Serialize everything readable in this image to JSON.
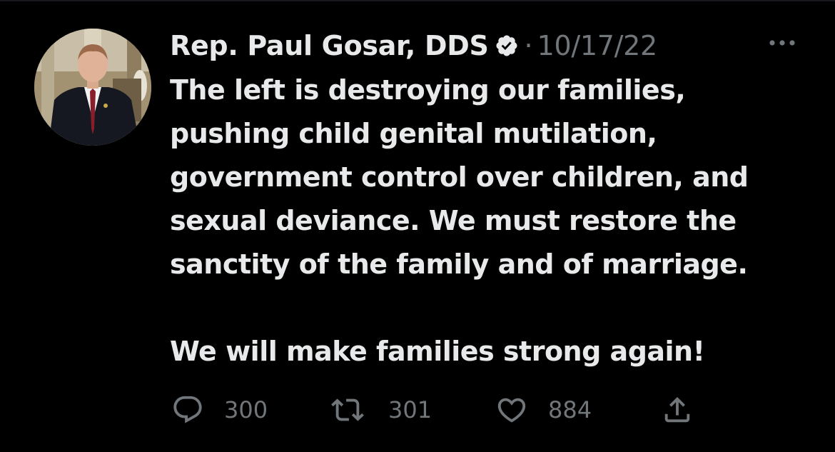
{
  "tweet": {
    "author": {
      "display_name": "Rep. Paul Gosar, DDS",
      "verified": true,
      "avatar_icon": "profile-photo"
    },
    "separator": "·",
    "date": "10/17/22",
    "more_icon": "more-horizontal-icon",
    "text_lines": [
      "The left is destroying our families,",
      "pushing child genital mutilation,",
      "government control over children, and",
      "sexual deviance. We must restore the",
      "sanctity of the family and of marriage."
    ],
    "text_line_final": "We will make families strong again!",
    "actions": {
      "replies": "300",
      "retweets": "301",
      "likes": "884",
      "reply_icon": "speech-bubble-icon",
      "retweet_icon": "retweet-icon",
      "like_icon": "heart-icon",
      "share_icon": "share-icon"
    }
  },
  "colors": {
    "background": "#000000",
    "text_primary": "#e7e9ea",
    "text_secondary": "#71767b"
  }
}
